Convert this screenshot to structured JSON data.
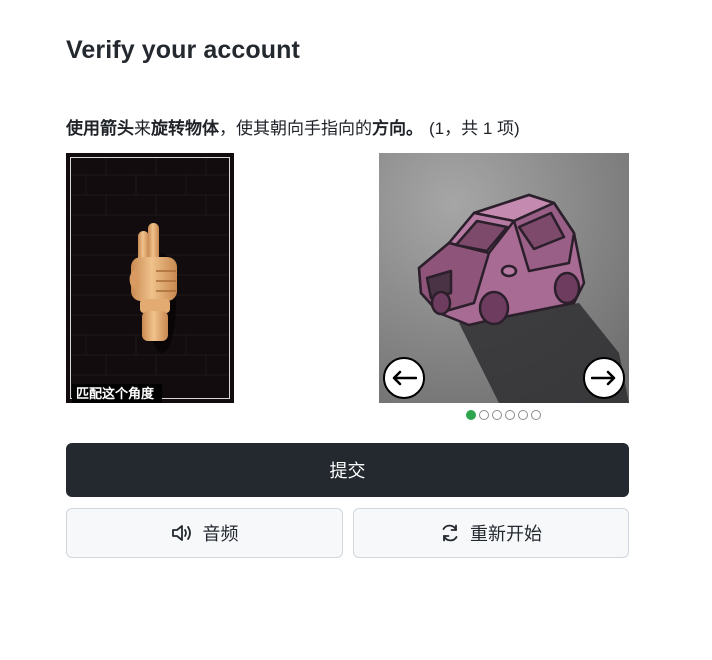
{
  "page": {
    "title": "Verify your account"
  },
  "instruction": {
    "part1_bold": "使用箭头",
    "part2": "来",
    "part3_bold": "旋转物体",
    "part4": "，使其朝向手指向的",
    "part5_bold": "方向。",
    "count": "(1，共 1 项)"
  },
  "reference": {
    "caption": "匹配这个角度",
    "image": "hand-pointing-up"
  },
  "puzzle": {
    "image": "pink-car-3d",
    "prev_icon": "arrow-left-icon",
    "next_icon": "arrow-right-icon",
    "dots_total": 6,
    "dots_active_index": 0
  },
  "buttons": {
    "submit_label": "提交",
    "audio_label": "音频",
    "restart_label": "重新开始",
    "audio_icon": "speaker-icon",
    "restart_icon": "refresh-icon"
  },
  "colors": {
    "primary_button": "#24292f",
    "active_dot": "#2da44e",
    "secondary_button_bg": "#f6f8fa"
  }
}
